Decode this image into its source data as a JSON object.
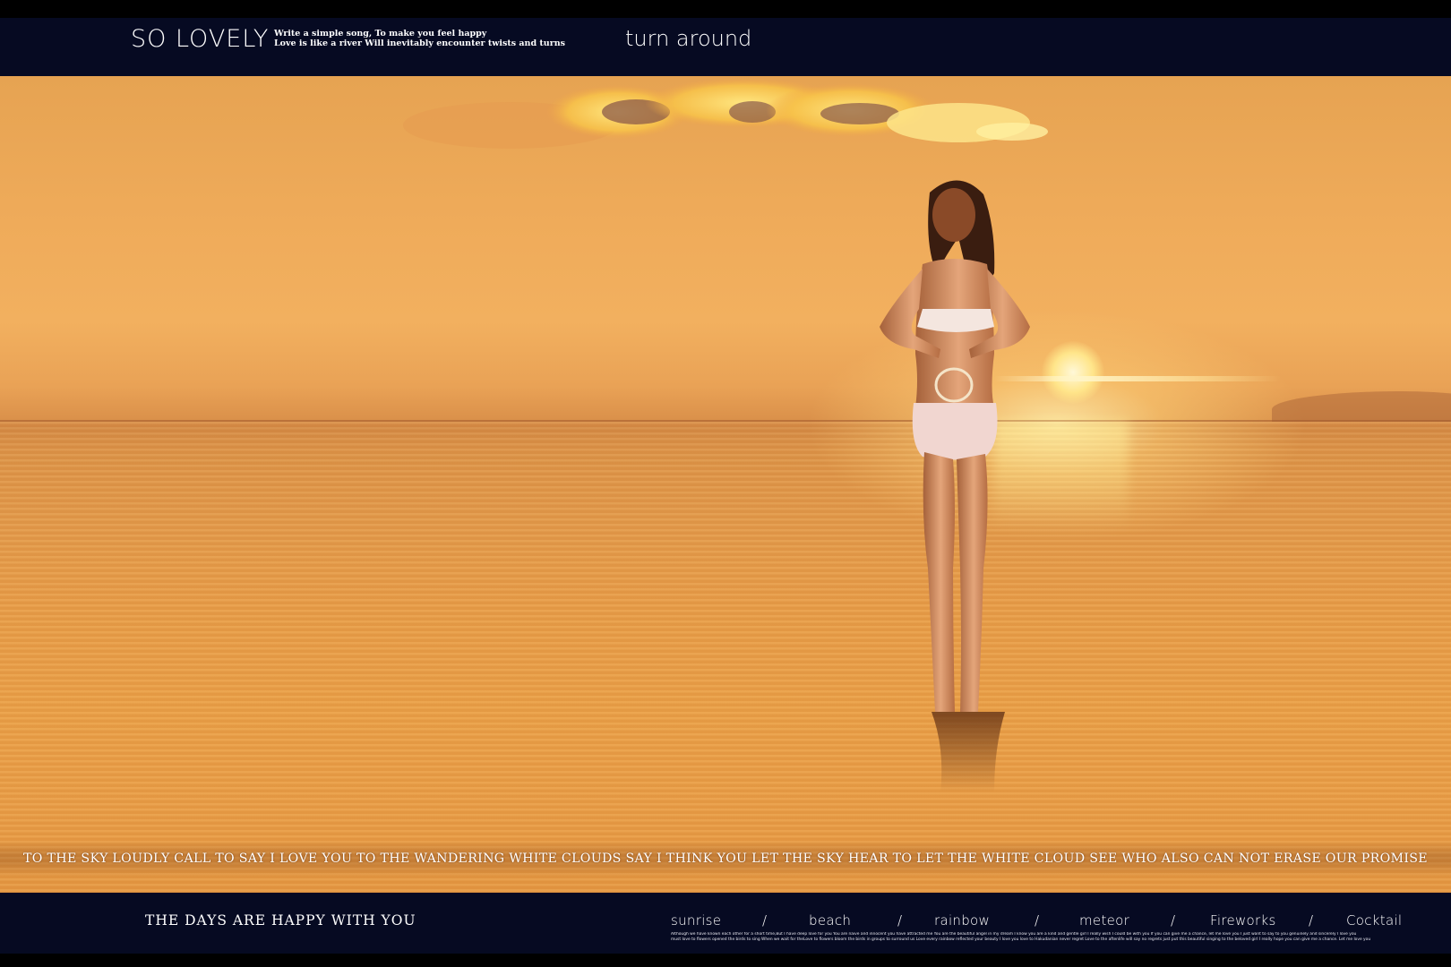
{
  "header": {
    "brand": "SO LOVELY",
    "tagline_line1": "Write a simple song,  To make you feel happy",
    "tagline_line2": "Love is like a river Will inevitably encounter twists and turns",
    "title": "turn around"
  },
  "photo": {
    "caption": "TO THE SKY LOUDLY CALL TO SAY I LOVE YOU TO THE WANDERING WHITE CLOUDS SAY I THINK YOU LET THE SKY HEAR TO LET THE WHITE CLOUD SEE WHO ALSO CAN NOT ERASE OUR PROMISE",
    "sky_color": "#efab5a",
    "water_color": "#e89d48",
    "sun_color": "#fff3c4"
  },
  "footer": {
    "slogan": "THE DAYS ARE HAPPY WITH YOU",
    "nav": {
      "item1": "sunrise",
      "sep1": "/",
      "item2": "beach",
      "sep2": "/",
      "item3": "rainbow",
      "sep3": "/",
      "item4": "meteor",
      "sep4": "/",
      "item5": "Fireworks",
      "sep5": "/",
      "item6": "Cocktail"
    },
    "fine_line1": "Although we have known each other for a short time,But I have deep love for you  You are naive and  innocent you have  attracted me You are the beautiful angel in  my  dream I know you are a kind and gentle girl  I really wish I  could be with you  If you can give me a chance, let me love you I just  want to say to you genuinely and sincerely I love you",
    "fine_line2": "must love to flowers opened the birds to sing When we wait for theLove to  flowers bloom the birds in groups to surround us Love every rainbow reflected your beauty I love you love to Hakudanian never regret Love to the aftenlife will say no regrets just put this beautiful singing to the beloved girl I really hope you can give me a chance. Let me love you"
  }
}
